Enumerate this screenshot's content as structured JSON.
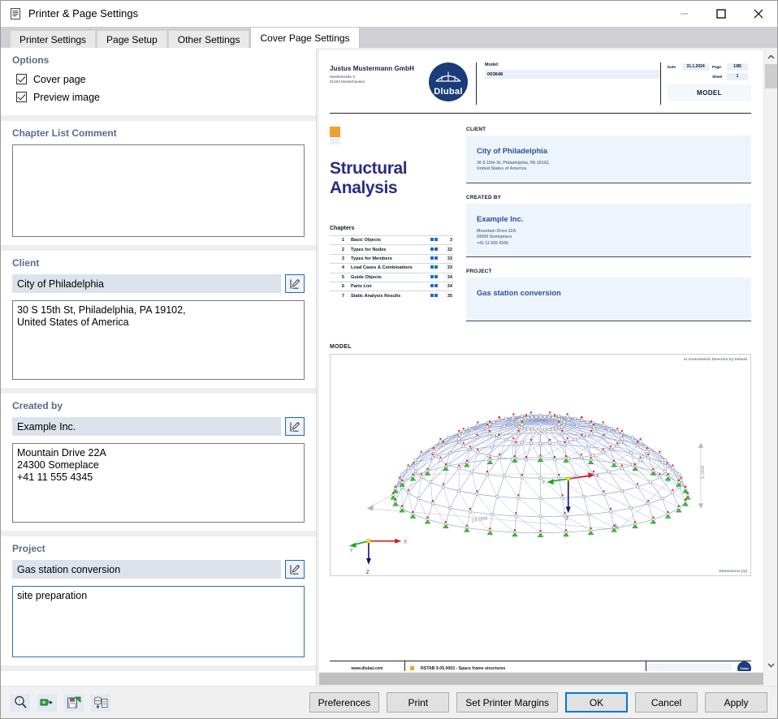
{
  "window": {
    "title": "Printer & Page Settings",
    "icon": "document-icon",
    "minimize": "—",
    "maximize": "□",
    "close": "✕"
  },
  "tabs": [
    {
      "label": "Printer Settings",
      "active": false
    },
    {
      "label": "Page Setup",
      "active": false
    },
    {
      "label": "Other Settings",
      "active": false
    },
    {
      "label": "Cover Page Settings",
      "active": true
    }
  ],
  "settings": {
    "options": {
      "title": "Options",
      "cover_page": {
        "label": "Cover page",
        "checked": true
      },
      "preview_image": {
        "label": "Preview image",
        "checked": true
      }
    },
    "chapter_list_comment": {
      "title": "Chapter List Comment",
      "value": ""
    },
    "client": {
      "title": "Client",
      "name": "City of Philadelphia",
      "edit_icon": "pencil-edit-icon",
      "address": "30 S 15th St, Philadelphia, PA 19102,\nUnited States of America"
    },
    "created_by": {
      "title": "Created by",
      "name": "Example Inc.",
      "edit_icon": "pencil-edit-icon",
      "address": "Mountain Drive 22A\n24300 Someplace\n+41 11 555 4345"
    },
    "project": {
      "title": "Project",
      "name": "Gas station conversion",
      "edit_icon": "pencil-edit-icon",
      "description": "site preparation"
    }
  },
  "preview": {
    "header": {
      "company_name": "Justus Mustermann GmbH",
      "company_address": "Musterstraße 5\n01234 Musterhausen",
      "logo_text": "Dlubal",
      "model_label": "Model:",
      "model_value": "003646",
      "date_label": "Date",
      "date_value": "31.1.2024",
      "page_label": "Page",
      "page_value": "1/85",
      "sheet_label": "Sheet",
      "sheet_value": "1",
      "box_title": "MODEL"
    },
    "title": "Structural\nAnalysis",
    "chapters_heading": "Chapters",
    "chapters": [
      {
        "num": "1",
        "name": "Basic Objects",
        "page": "3"
      },
      {
        "num": "2",
        "name": "Types for Nodes",
        "page": "32"
      },
      {
        "num": "3",
        "name": "Types for Members",
        "page": "33"
      },
      {
        "num": "4",
        "name": "Load Cases & Combinations",
        "page": "33"
      },
      {
        "num": "5",
        "name": "Guide Objects",
        "page": "34"
      },
      {
        "num": "6",
        "name": "Parts List",
        "page": "34"
      },
      {
        "num": "7",
        "name": "Static Analysis Results",
        "page": "35"
      }
    ],
    "sections": [
      {
        "label": "CLIENT",
        "name": "City of Philadelphia",
        "address": "30 S 15th St, Philadelphia, PA 19102,\nUnited States of America"
      },
      {
        "label": "CREATED BY",
        "name": "Example Inc.",
        "address": "Mountain Drive 22A\n24300 Someplace\n+41 11 555 4345"
      },
      {
        "label": "PROJECT",
        "name": "Gas station conversion",
        "address": ""
      }
    ],
    "model": {
      "label": "MODEL",
      "view_note": "In Axonometric Direction by Default",
      "units_note": "Dimensions [m]",
      "span_dimension": "24.000",
      "height_dimension": "5.500",
      "axis_x": "X",
      "axis_y": "Y",
      "axis_z": "Z"
    },
    "footer": {
      "website": "www.dlubal.com",
      "program": "RSTAB 9.05.0003 - Space frame structures",
      "logo_text": "Dlubal"
    }
  },
  "toolbar_icons": [
    {
      "name": "preview-zoom-icon",
      "glyph": "search-question-icon"
    },
    {
      "name": "load-settings-icon",
      "glyph": "import-icon"
    },
    {
      "name": "save-settings-icon",
      "glyph": "save-icon"
    },
    {
      "name": "export-database-icon",
      "glyph": "database-document-icon"
    }
  ],
  "buttons": {
    "preferences": "Preferences",
    "print": "Print",
    "set_printer_margins": "Set Printer Margins",
    "ok": "OK",
    "cancel": "Cancel",
    "apply": "Apply"
  },
  "colors": {
    "accent_blue": "#2b4f9e",
    "group_title": "#5a6b8c",
    "field_bg": "#dde3ec",
    "primary_border": "#0078d7",
    "logo_navy": "#1b3c7a",
    "orange": "#eba32d"
  }
}
